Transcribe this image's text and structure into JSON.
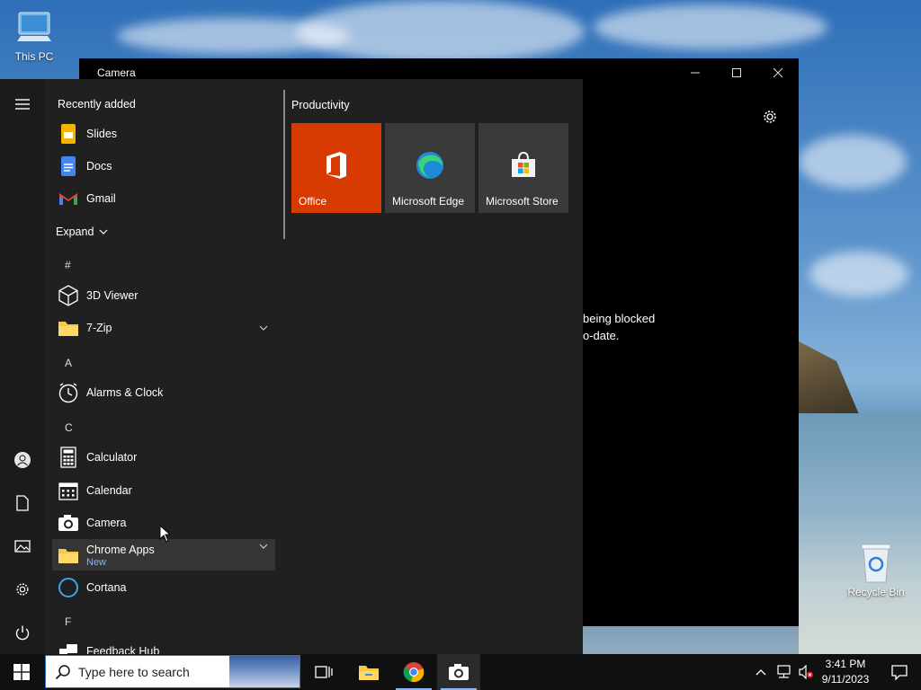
{
  "desktop": {
    "icons": [
      {
        "label": "This PC"
      },
      {
        "label": "Recycle Bin"
      }
    ]
  },
  "camera_window": {
    "title": "Camera",
    "message_line1": "being blocked",
    "message_line2": "o-date."
  },
  "start_menu": {
    "recently_added_label": "Recently added",
    "recent": [
      {
        "label": "Slides",
        "icon": "google-slides-icon"
      },
      {
        "label": "Docs",
        "icon": "google-docs-icon"
      },
      {
        "label": "Gmail",
        "icon": "gmail-icon"
      }
    ],
    "expand_label": "Expand",
    "letters": [
      "#",
      "A",
      "C",
      "F"
    ],
    "apps": [
      {
        "label": "3D Viewer",
        "icon": "3d-viewer-icon"
      },
      {
        "label": "7-Zip",
        "icon": "folder-icon"
      },
      {
        "label": "Alarms & Clock",
        "icon": "alarm-clock-icon"
      },
      {
        "label": "Calculator",
        "icon": "calculator-icon"
      },
      {
        "label": "Calendar",
        "icon": "calendar-icon"
      },
      {
        "label": "Camera",
        "icon": "camera-icon"
      },
      {
        "label": "Chrome Apps",
        "sub": "New",
        "icon": "folder-icon"
      },
      {
        "label": "Cortana",
        "icon": "cortana-icon"
      },
      {
        "label": "Feedback Hub",
        "icon": "feedback-hub-icon"
      }
    ],
    "tiles_group": "Productivity",
    "tiles": [
      {
        "label": "Office",
        "color": "#d83b01"
      },
      {
        "label": "Microsoft Edge",
        "color": "#3a3a3a"
      },
      {
        "label": "Microsoft Store",
        "color": "#3a3a3a"
      }
    ]
  },
  "taskbar": {
    "search_placeholder": "Type here to search",
    "time": "3:41 PM",
    "date": "9/11/2023"
  }
}
